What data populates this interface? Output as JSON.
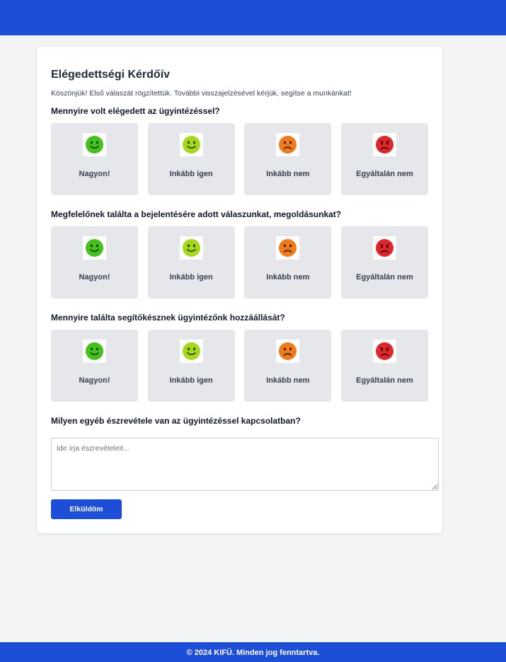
{
  "colors": {
    "brand": "#1d4ed8",
    "page_bg": "#f3f4f6",
    "option_bg": "#e5e7eb",
    "face_very_happy": "#43c21b",
    "face_happy": "#a6d81a",
    "face_sad": "#f07a19",
    "face_angry": "#e0262b"
  },
  "survey": {
    "title": "Elégedettségi Kérdőív",
    "subtitle": "Köszönjük! Első válaszát rögzítettük. További visszajelzésével kérjük, segítse a munkánkat!",
    "options": [
      {
        "label": "Nagyon!",
        "icon": "very-happy-face-icon"
      },
      {
        "label": "Inkább igen",
        "icon": "happy-face-icon"
      },
      {
        "label": "Inkább nem",
        "icon": "sad-face-icon"
      },
      {
        "label": "Egyáltalán nem",
        "icon": "angry-face-icon"
      }
    ],
    "questions": [
      {
        "text": "Mennyire volt elégedett az ügyintézéssel?"
      },
      {
        "text": "Megfelelőnek találta a bejelentésére adott válaszunkat, megoldásunkat?"
      },
      {
        "text": "Mennyire találta segítőkésznek ügyintézőnk hozzáállását?"
      }
    ],
    "comment_question": "Milyen egyéb észrevétele van az ügyintézéssel kapcsolatban?",
    "comment_placeholder": "Ide írja észrevételeit...",
    "submit_label": "Elküldöm"
  },
  "footer": {
    "text": "© 2024 KIFÜ. Minden jog fenntartva."
  }
}
